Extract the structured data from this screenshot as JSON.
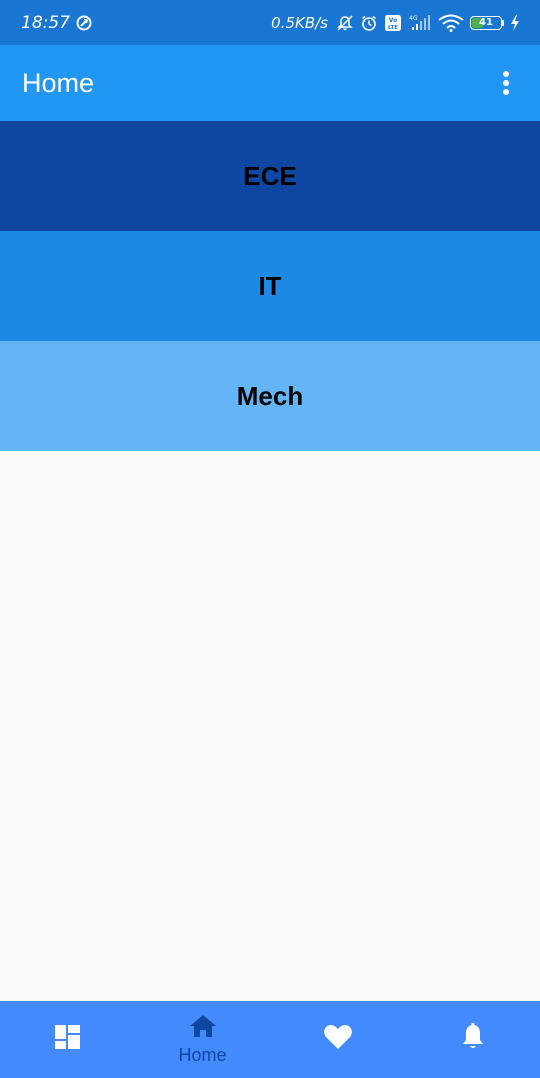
{
  "status_bar": {
    "time": "18:57",
    "net_speed": "0.5KB/s",
    "battery_level": "41",
    "battery_fraction": 0.41,
    "icons": [
      "sync-icon",
      "mute-icon",
      "alarm-icon",
      "volte-icon",
      "signal-icon",
      "wifi-icon",
      "battery-icon",
      "charging-icon"
    ]
  },
  "app_bar": {
    "title": "Home",
    "menu_icon": "more-vert-icon"
  },
  "list": {
    "items": [
      {
        "label": "ECE",
        "color": "#0d47a1"
      },
      {
        "label": "IT",
        "color": "#1e88e5"
      },
      {
        "label": "Mech",
        "color": "#64b5f6"
      }
    ]
  },
  "bottom_nav": {
    "items": [
      {
        "icon": "dashboard-icon",
        "label": ""
      },
      {
        "icon": "home-icon",
        "label": "Home",
        "active": true
      },
      {
        "icon": "heart-icon",
        "label": ""
      },
      {
        "icon": "bell-icon",
        "label": ""
      }
    ]
  },
  "colors": {
    "status_bar": "#1976d2",
    "app_bar": "#2196f3",
    "background": "#fafafa",
    "bottom_nav": "#448aff",
    "active_nav": "#0d47a1"
  }
}
